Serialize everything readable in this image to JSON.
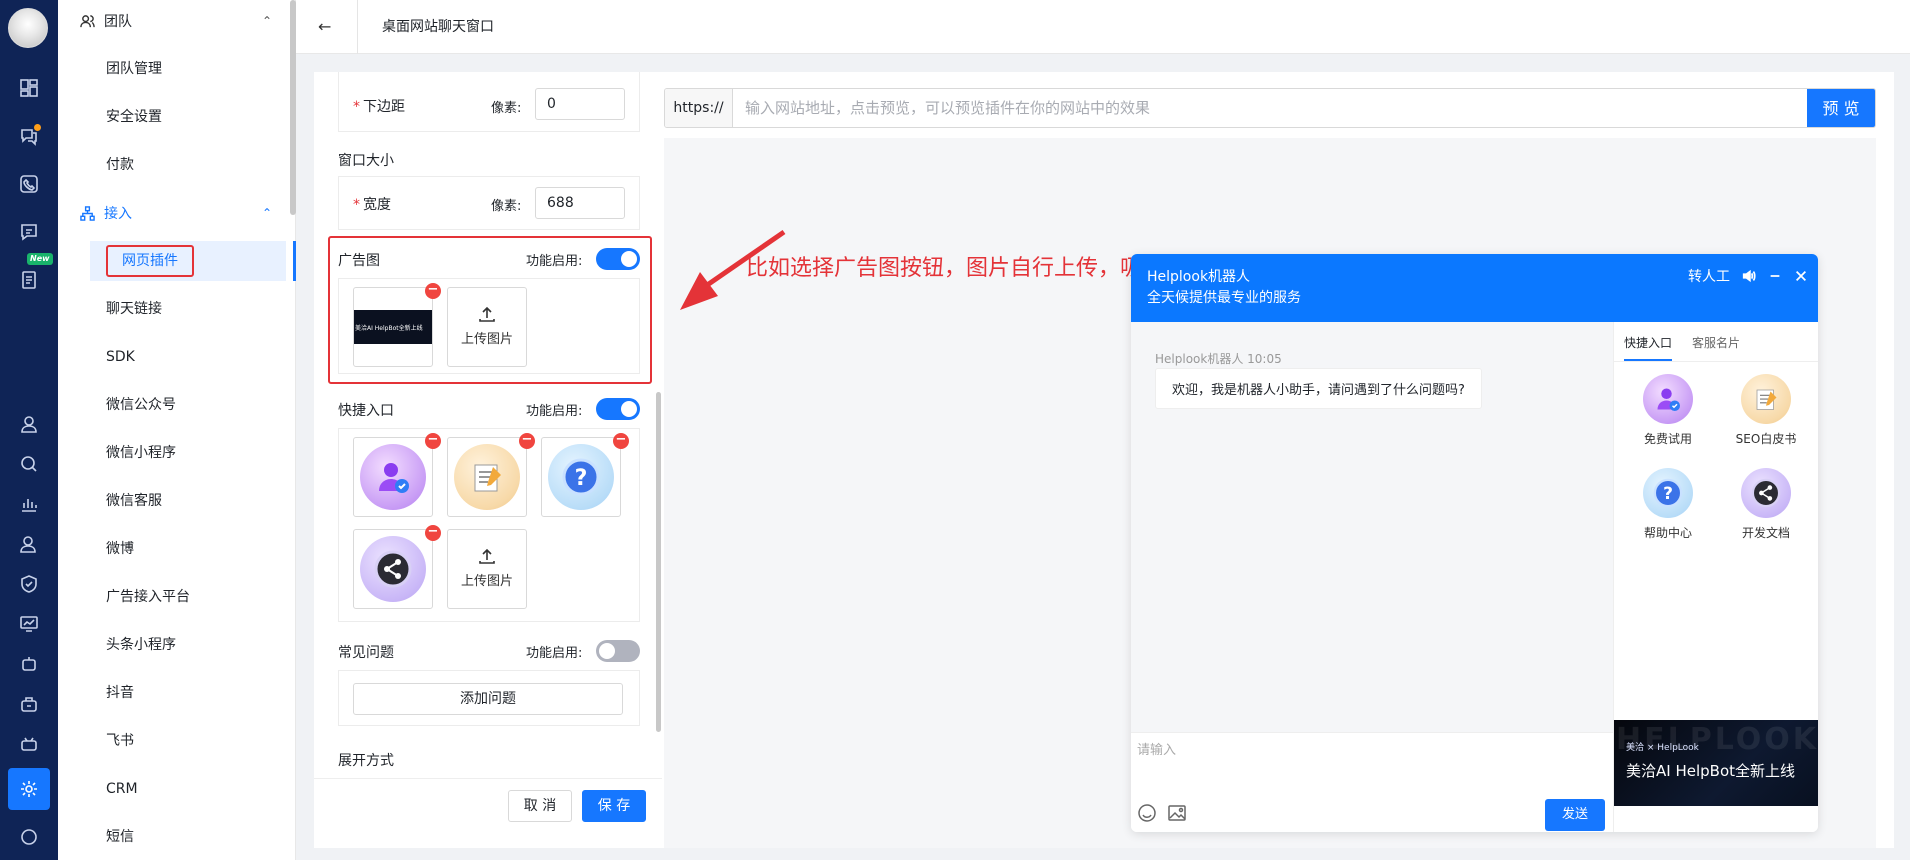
{
  "sidebar": {
    "groups": [
      {
        "label": "团队",
        "icon": "team-icon"
      },
      {
        "label": "接入",
        "icon": "access-icon"
      }
    ],
    "team_items": [
      "团队管理",
      "安全设置",
      "付款"
    ],
    "access_items": [
      "网页插件",
      "聊天链接",
      "SDK",
      "微信公众号",
      "微信小程序",
      "微信客服",
      "微博",
      "广告接入平台",
      "头条小程序",
      "抖音",
      "飞书",
      "CRM",
      "短信"
    ],
    "new_badge": "New"
  },
  "header": {
    "title": "桌面网站聊天窗口"
  },
  "settings": {
    "bottom_margin_label": "下边距",
    "px_label": "像素:",
    "bottom_margin_value": "0",
    "window_size_label": "窗口大小",
    "width_label": "宽度",
    "width_value": "688",
    "ad_image_label": "广告图",
    "enable_label": "功能启用:",
    "ad_thumb_text": "美洽AI HelpBot全新上线",
    "upload_label": "上传图片",
    "quick_entry_label": "快捷入口",
    "faq_label": "常见问题",
    "add_question": "添加问题",
    "expand_label": "展开方式",
    "cancel": "取 消",
    "save": "保 存",
    "toggles": {
      "ad": true,
      "quick": true,
      "faq": false
    }
  },
  "preview": {
    "url_prefix": "https://",
    "url_placeholder": "输入网站地址，点击预览，可以预览插件在你的网站中的效果",
    "preview_button": "预 览",
    "annotation": "比如选择广告图按钮，图片自行上传，吸引访客点击"
  },
  "chat": {
    "name": "Helplook机器人",
    "subtitle": "全天候提供最专业的服务",
    "transfer": "转人工",
    "msg_meta": "Helplook机器人 10:05",
    "msg": "欢迎，我是机器人小助手，请问遇到了什么问题吗?",
    "input_placeholder": "请输入",
    "send": "发送",
    "tabs": [
      "快捷入口",
      "客服名片"
    ],
    "quick_items": [
      {
        "label": "免费试用",
        "icon": "free-trial-icon"
      },
      {
        "label": "SEO白皮书",
        "icon": "seo-whitepaper-icon"
      },
      {
        "label": "帮助中心",
        "icon": "help-center-icon"
      },
      {
        "label": "开发文档",
        "icon": "dev-docs-icon"
      }
    ],
    "ad": {
      "watermark": "HELPLOOK",
      "brand": "美洽 × HelpLook",
      "headline": "美洽AI HelpBot全新上线"
    }
  },
  "colors": {
    "primary": "#1677ff",
    "highlight_red": "#e43338",
    "rail_bg": "#0f2456"
  }
}
